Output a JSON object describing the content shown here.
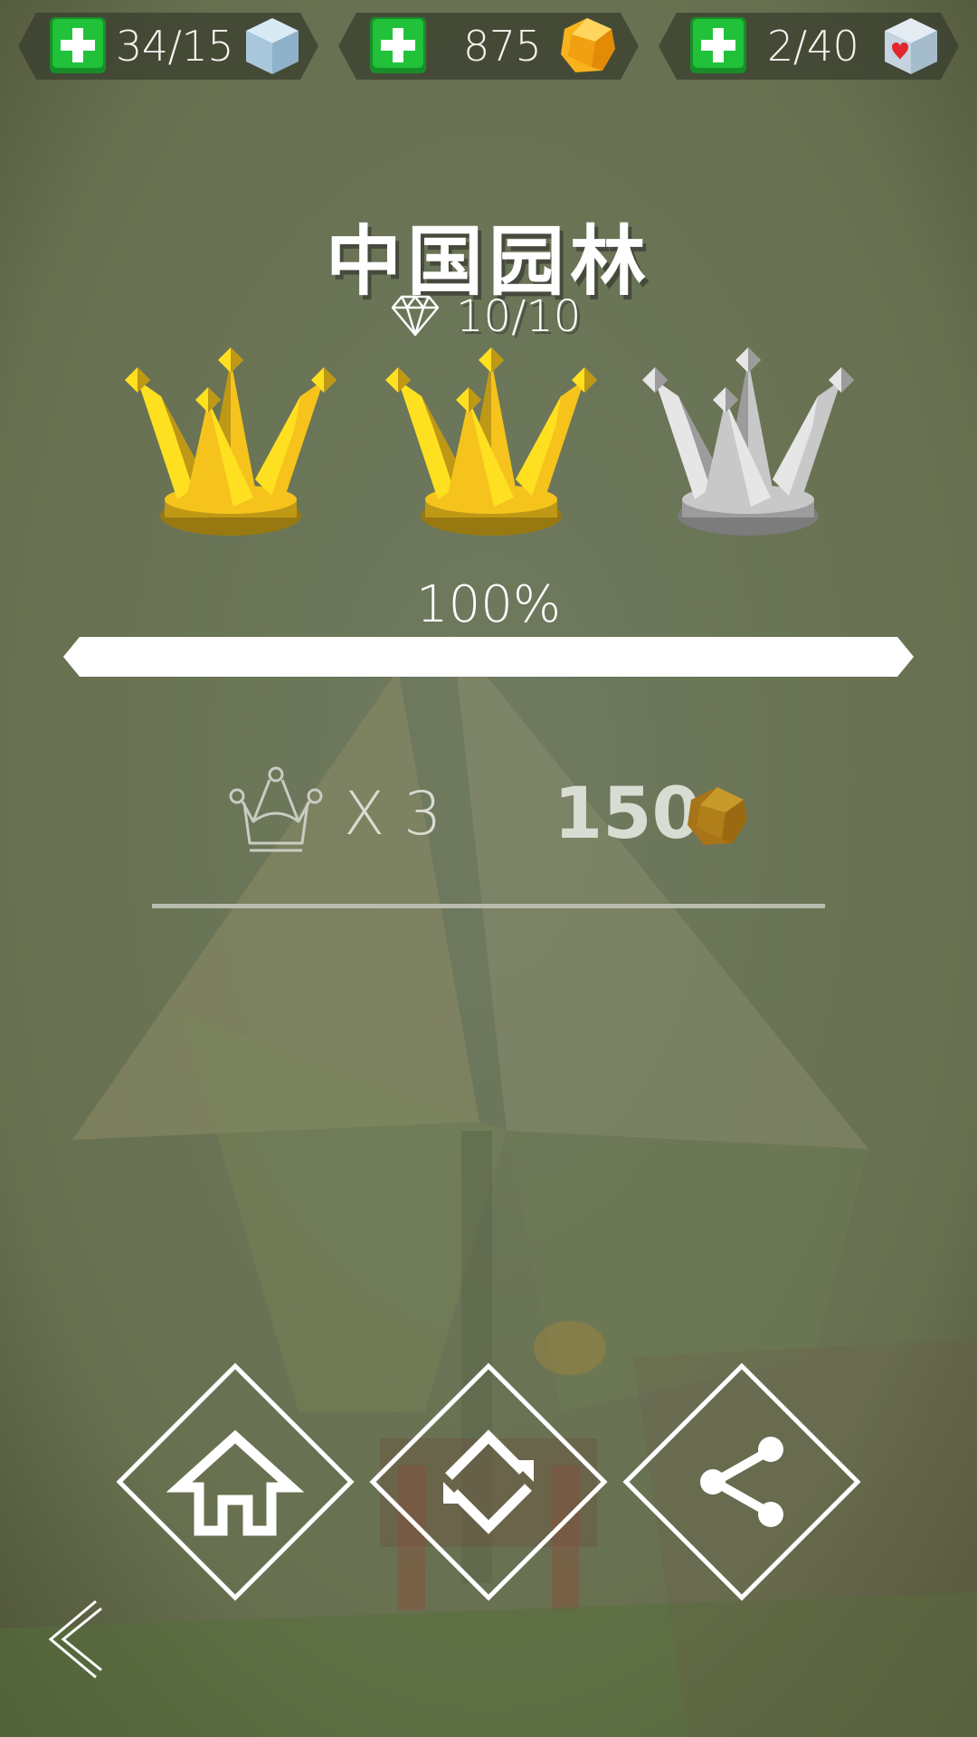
{
  "resources": [
    {
      "value": "34/15",
      "icon": "lives-cube-icon",
      "plus_icon": "add-lives-plus-icon"
    },
    {
      "value": "875",
      "icon": "gold-coin-icon",
      "plus_icon": "add-coins-plus-icon"
    },
    {
      "value": "2/40",
      "icon": "heart-cube-icon",
      "plus_icon": "add-hearts-plus-icon"
    }
  ],
  "level": {
    "title": "中国园林",
    "gems": "10/10"
  },
  "crowns": {
    "earned": 2,
    "total": 3,
    "colors": {
      "gold": "#f5c31c",
      "silver": "#c8c8c8"
    }
  },
  "progress": {
    "label": "100%",
    "fraction": 1.0
  },
  "rewards": {
    "crown_count": "X 3",
    "coins": "150",
    "crown_icon": "crown-outline-icon",
    "coin_icon": "gold-coin-icon"
  },
  "actions": {
    "home": "home-icon",
    "replay": "replay-icon",
    "share": "share-icon",
    "back": "back-arrow-icon"
  },
  "colors": {
    "plus_green": "#1fb832",
    "bar_white": "#ffffff",
    "pill_dark": "#3a3d2f"
  }
}
